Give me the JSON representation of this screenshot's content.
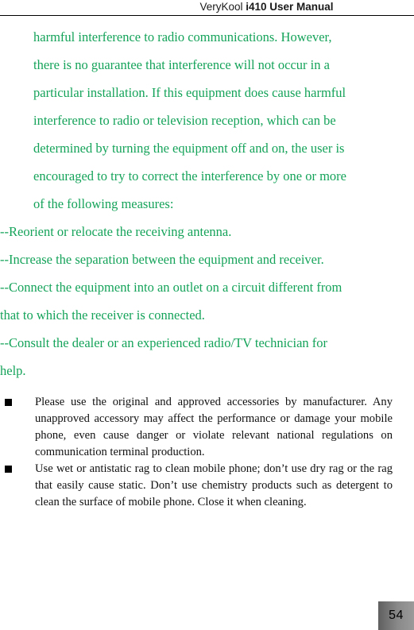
{
  "header": {
    "brand": "VeryKool",
    "model": "i410 User Manual"
  },
  "body": {
    "fcc_paragraph_lines": [
      "harmful interference to radio communications. However,",
      "there is no guarantee that interference will not occur in a",
      "particular installation. If this equipment does cause harmful",
      "interference to radio or television reception, which can be",
      "determined by turning the equipment off and on, the user is",
      "encouraged to try to correct the interference by one or more",
      "of the following measures:"
    ],
    "measures_lines": [
      "--Reorient or relocate the receiving antenna.",
      "--Increase the separation between the equipment and receiver.",
      "--Connect the equipment into an outlet on a circuit different from",
      "that to which the receiver is connected.",
      "--Consult the dealer or an experienced radio/TV technician for",
      "help."
    ],
    "notices": [
      {
        "bullet": "filled-square-bullet",
        "text": "Please use the original and approved accessories by manufacturer. Any unapproved accessory may affect the performance or damage your mobile phone, even cause danger or violate relevant national regulations on communication terminal production."
      },
      {
        "bullet": "filled-square-bullet",
        "text": "Use wet or antistatic rag to clean mobile phone; don’t use dry rag or the rag that easily cause static. Don’t use chemistry products such as detergent to clean the surface of mobile phone. Close it when cleaning."
      }
    ]
  },
  "footer": {
    "page_number": "54"
  },
  "colors": {
    "green_text": "#15a35a",
    "body_text": "#101010",
    "rule": "#000000",
    "footer_box": "#8a8a8a"
  }
}
